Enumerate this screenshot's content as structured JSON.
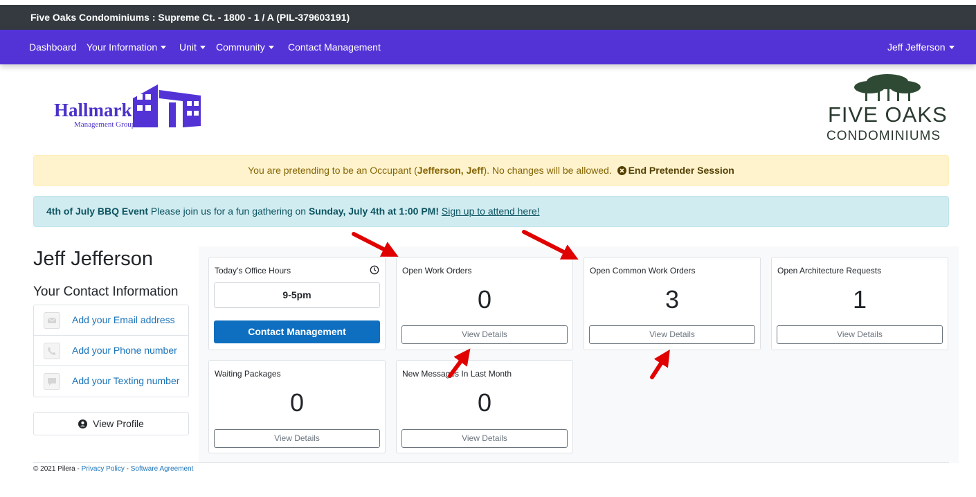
{
  "topbar": {
    "title": "Five Oaks Condominiums : Supreme Ct. - 1800 - 1 / A (PIL-379603191)"
  },
  "nav": {
    "items": [
      {
        "label": "Dashboard",
        "dropdown": false
      },
      {
        "label": "Your Information",
        "dropdown": true
      },
      {
        "label": "Unit",
        "dropdown": true
      },
      {
        "label": "Community",
        "dropdown": true
      },
      {
        "label": "Contact Management",
        "dropdown": false
      }
    ],
    "user": "Jeff Jefferson"
  },
  "logos": {
    "left": {
      "word": "Hallmark",
      "sub": "Management Group"
    },
    "right": {
      "line1": "FIVE OAKS",
      "line2": "CONDOMINIUMS"
    }
  },
  "alerts": {
    "pretender": {
      "text_before": "You are pretending to be an Occupant (",
      "name": "Jefferson, Jeff",
      "text_after": "). No changes will be allowed.",
      "end_label": "End Pretender Session"
    },
    "event": {
      "title": "4th of July BBQ Event",
      "text": "Please join us for a fun gathering on",
      "when": "Sunday, July 4th at 1:00 PM!",
      "link": "Sign up to attend here!"
    }
  },
  "profile": {
    "name": "Jeff Jefferson",
    "contact_heading": "Your Contact Information",
    "contacts": [
      {
        "label": "Add your Email address",
        "icon": "envelope-icon"
      },
      {
        "label": "Add your Phone number",
        "icon": "phone-icon"
      },
      {
        "label": "Add your Texting number",
        "icon": "chat-icon"
      }
    ],
    "view_profile_label": "View Profile"
  },
  "cards": {
    "office_hours": {
      "title": "Today's Office Hours",
      "hours": "9-5pm",
      "button": "Contact Management"
    },
    "work_orders": {
      "title": "Open Work Orders",
      "value": "0",
      "button": "View Details"
    },
    "common_work_orders": {
      "title": "Open Common Work Orders",
      "value": "3",
      "button": "View Details"
    },
    "architecture": {
      "title": "Open Architecture Requests",
      "value": "1",
      "button": "View Details"
    },
    "packages": {
      "title": "Waiting Packages",
      "value": "0",
      "button": "View Details"
    },
    "messages": {
      "title": "New Messages In Last Month",
      "value": "0",
      "button": "View Details"
    }
  },
  "footer": {
    "copyright": "© 2021 Pilera - ",
    "privacy": "Privacy Policy",
    "sep": " - ",
    "agreement": "Software Agreement"
  },
  "colors": {
    "topbar": "#343a40",
    "navbar": "#5433d6",
    "primary_button": "#0e6fc0",
    "annotation_arrow": "#e00000"
  }
}
